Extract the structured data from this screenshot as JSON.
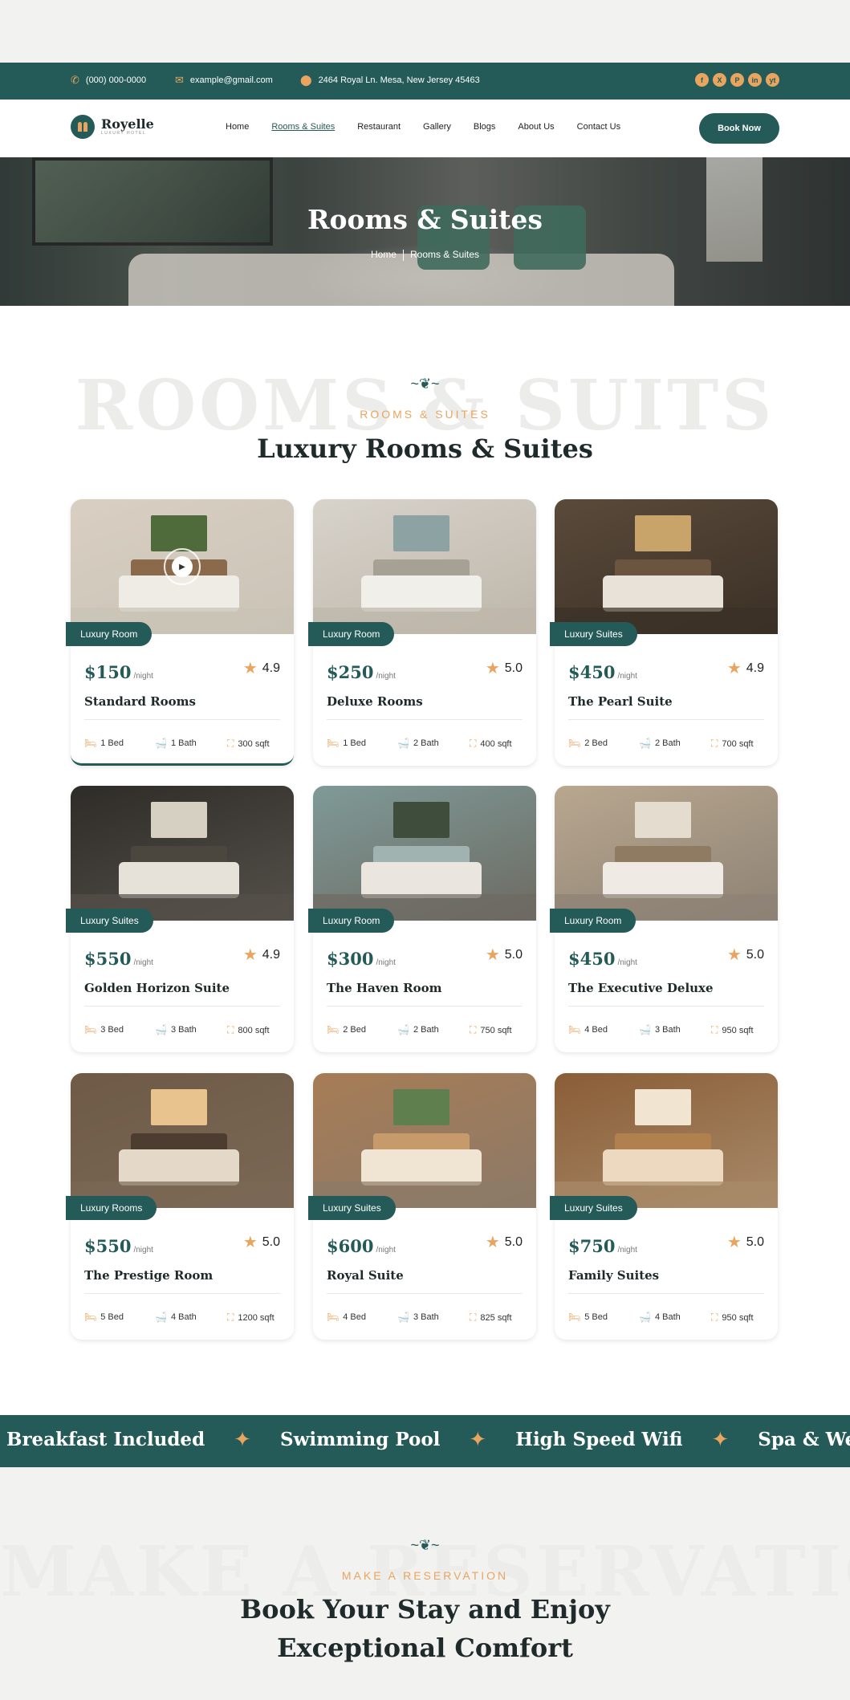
{
  "topbar": {
    "phone": "(000) 000-0000",
    "email": "example@gmail.com",
    "address": "2464 Royal Ln. Mesa, New Jersey 45463",
    "socials": [
      "f",
      "X",
      "P",
      "in",
      "yt"
    ]
  },
  "brand": {
    "name": "Royelle",
    "tagline": "LUXURY HOTEL"
  },
  "nav": {
    "links": [
      "Home",
      "Rooms & Suites",
      "Restaurant",
      "Gallery",
      "Blogs",
      "About Us",
      "Contact Us"
    ],
    "active": "Rooms & Suites",
    "cta": "Book Now"
  },
  "hero": {
    "title": "Rooms & Suites",
    "crumb_home": "Home",
    "crumb_current": "Rooms & Suites"
  },
  "rooms_section": {
    "ghost": "ROOMS & SUITS",
    "eyebrow": "ROOMS & SUITES",
    "title": "Luxury Rooms & Suites"
  },
  "rooms": [
    {
      "badge": "Luxury Room",
      "price": "$150",
      "per": "/night",
      "rating": "4.9",
      "name": "Standard Rooms",
      "bed": "1 Bed",
      "bath": "1 Bath",
      "area": "300 sqft"
    },
    {
      "badge": "Luxury Room",
      "price": "$250",
      "per": "/night",
      "rating": "5.0",
      "name": "Deluxe Rooms",
      "bed": "1 Bed",
      "bath": "2 Bath",
      "area": "400 sqft"
    },
    {
      "badge": "Luxury Suites",
      "price": "$450",
      "per": "/night",
      "rating": "4.9",
      "name": "The Pearl Suite",
      "bed": "2 Bed",
      "bath": "2 Bath",
      "area": "700 sqft"
    },
    {
      "badge": "Luxury Suites",
      "price": "$550",
      "per": "/night",
      "rating": "4.9",
      "name": "Golden Horizon Suite",
      "bed": "3 Bed",
      "bath": "3 Bath",
      "area": "800 sqft"
    },
    {
      "badge": "Luxury Room",
      "price": "$300",
      "per": "/night",
      "rating": "5.0",
      "name": "The Haven Room",
      "bed": "2 Bed",
      "bath": "2 Bath",
      "area": "750 sqft"
    },
    {
      "badge": "Luxury Room",
      "price": "$450",
      "per": "/night",
      "rating": "5.0",
      "name": "The Executive Deluxe",
      "bed": "4 Bed",
      "bath": "3 Bath",
      "area": "950 sqft"
    },
    {
      "badge": "Luxury Rooms",
      "price": "$550",
      "per": "/night",
      "rating": "5.0",
      "name": "The Prestige Room",
      "bed": "5 Bed",
      "bath": "4 Bath",
      "area": "1200 sqft"
    },
    {
      "badge": "Luxury Suites",
      "price": "$600",
      "per": "/night",
      "rating": "5.0",
      "name": "Royal Suite",
      "bed": "4 Bed",
      "bath": "3 Bath",
      "area": "825 sqft"
    },
    {
      "badge": "Luxury Suites",
      "price": "$750",
      "per": "/night",
      "rating": "5.0",
      "name": "Family Suites",
      "bed": "5 Bed",
      "bath": "4 Bath",
      "area": "950 sqft"
    }
  ],
  "amenities": [
    "Breakfast Included",
    "Swimming Pool",
    "High Speed Wifi",
    "Spa & Wellness"
  ],
  "reservation": {
    "ghost": "MAKE A RESERVATION",
    "eyebrow": "MAKE A RESERVATION",
    "title_line1": "Book Your Stay and Enjoy",
    "title_line2": "Exceptional Comfort"
  },
  "colors": {
    "primary": "#245a57",
    "accent": "#e9a55f",
    "page_bg": "#f2f2f1"
  }
}
